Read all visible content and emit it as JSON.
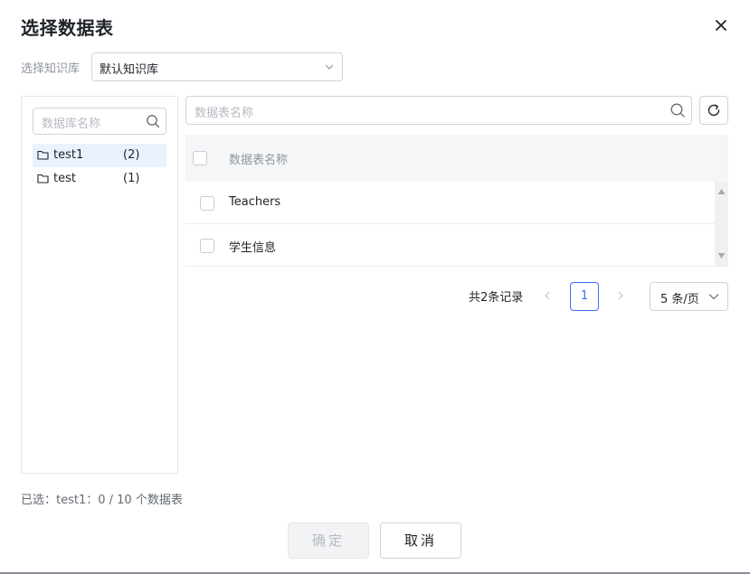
{
  "dialog": {
    "title": "选择数据表"
  },
  "knowledge_base": {
    "label": "选择知识库",
    "selected": "默认知识库"
  },
  "db_panel": {
    "search_placeholder": "数据库名称",
    "items": [
      {
        "name": "test1",
        "count": "(2)",
        "active": true
      },
      {
        "name": "test",
        "count": "(1)",
        "active": false
      }
    ]
  },
  "table_panel": {
    "search_placeholder": "数据表名称",
    "column_header": "数据表名称",
    "rows": [
      {
        "name": "Teachers"
      },
      {
        "name": "学生信息"
      }
    ]
  },
  "pagination": {
    "total": "共2条记录",
    "current_page": "1",
    "page_size": "5 条/页"
  },
  "footer": {
    "selected_info": "已选：test1：0 / 10 个数据表",
    "ok_label": "确定",
    "cancel_label": "取消"
  },
  "colors": {
    "accent": "#3370ff",
    "active_bg": "#eaf2fe",
    "border": "#d0d3d6"
  },
  "icons": {
    "close": "close-icon",
    "dropdown": "chevron-down-icon",
    "search": "search-icon",
    "folder": "folder-icon",
    "refresh": "refresh-icon",
    "prev": "chevron-left-icon",
    "next": "chevron-right-icon"
  }
}
